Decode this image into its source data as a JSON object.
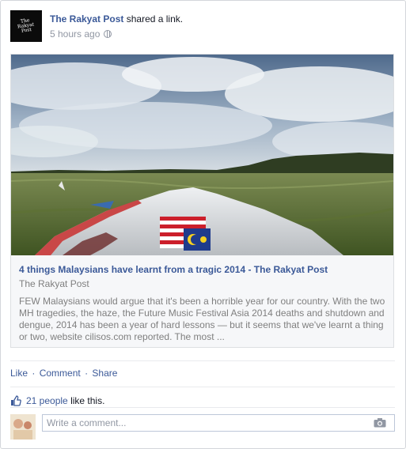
{
  "post": {
    "page_name": "The Rakyat Post",
    "verb": "shared a link.",
    "time": "5 hours ago",
    "avatar_text": "The\nRakyat\nPost",
    "privacy_icon": "globe-icon"
  },
  "link": {
    "title": "4 things Malaysians have learnt from a tragic 2014 - The Rakyat Post",
    "source": "The Rakyat Post",
    "description": "FEW Malaysians would argue that it's been a horrible year for our country. With the two MH tragedies, the haze, the Future Music Festival Asia 2014 deaths and shutdown and dengue, 2014 has been a year of hard lessons — but it seems that we've learnt a thing or two, website cilisos.com reported. The most ..."
  },
  "actions": {
    "like": "Like",
    "comment": "Comment",
    "share": "Share",
    "separator": "·"
  },
  "likes": {
    "count": "21 people",
    "suffix": "like this.",
    "icon": "thumbs-up-icon"
  },
  "comment": {
    "placeholder": "Write a comment...",
    "camera_icon": "camera-icon"
  },
  "colors": {
    "link_blue": "#3b5998",
    "muted": "#9197a3",
    "border": "#d3d6db"
  }
}
